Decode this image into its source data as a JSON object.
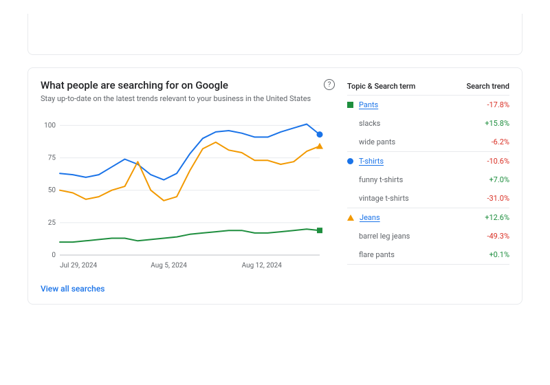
{
  "card": {
    "title": "What people are searching for on Google",
    "subtitle": "Stay up-to-date on the latest trends relevant to your business in the United States",
    "help_glyph": "?",
    "view_all": "View all searches"
  },
  "table": {
    "col_topic": "Topic & Search term",
    "col_trend": "Search trend"
  },
  "topics": [
    {
      "marker": "pants",
      "name": "Pants",
      "trend": "-17.8%",
      "trend_dir": "neg",
      "terms": [
        {
          "name": "slacks",
          "trend": "+15.8%",
          "trend_dir": "pos"
        },
        {
          "name": "wide pants",
          "trend": "-6.2%",
          "trend_dir": "neg"
        }
      ]
    },
    {
      "marker": "tshirts",
      "name": "T-shirts",
      "trend": "-10.6%",
      "trend_dir": "neg",
      "terms": [
        {
          "name": "funny t-shirts",
          "trend": "+7.0%",
          "trend_dir": "pos"
        },
        {
          "name": "vintage t-shirts",
          "trend": "-31.0%",
          "trend_dir": "neg"
        }
      ]
    },
    {
      "marker": "jeans",
      "name": "Jeans",
      "trend": "+12.6%",
      "trend_dir": "pos",
      "terms": [
        {
          "name": "barrel leg jeans",
          "trend": "-49.3%",
          "trend_dir": "neg"
        },
        {
          "name": "flare pants",
          "trend": "+0.1%",
          "trend_dir": "pos"
        }
      ]
    }
  ],
  "chart_data": {
    "type": "line",
    "title": "",
    "xlabel": "",
    "ylabel": "",
    "ylim": [
      0,
      105
    ],
    "yticks": [
      0,
      25,
      50,
      75,
      100
    ],
    "x_tick_labels": [
      "Jul 29, 2024",
      "Aug 5, 2024",
      "Aug 12, 2024"
    ],
    "x_tick_positions": [
      0,
      7,
      14
    ],
    "x": [
      0,
      1,
      2,
      3,
      4,
      5,
      6,
      7,
      8,
      9,
      10,
      11,
      12,
      13,
      14,
      15,
      16,
      17,
      18,
      19,
      20
    ],
    "series": [
      {
        "name": "Pants",
        "color": "#1e8e3e",
        "marker_shape": "square",
        "values": [
          10,
          10,
          11,
          12,
          13,
          13,
          11,
          12,
          13,
          14,
          16,
          17,
          18,
          19,
          19,
          17,
          17,
          18,
          19,
          20,
          19
        ]
      },
      {
        "name": "T-shirts",
        "color": "#1a73e8",
        "marker_shape": "circle",
        "values": [
          63,
          62,
          60,
          62,
          68,
          74,
          70,
          62,
          58,
          63,
          78,
          90,
          95,
          96,
          94,
          91,
          91,
          95,
          98,
          101,
          93
        ]
      },
      {
        "name": "Jeans",
        "color": "#f29900",
        "marker_shape": "triangle",
        "values": [
          50,
          48,
          43,
          45,
          50,
          53,
          72,
          50,
          42,
          45,
          65,
          82,
          87,
          81,
          79,
          73,
          73,
          70,
          72,
          80,
          84
        ]
      }
    ]
  }
}
